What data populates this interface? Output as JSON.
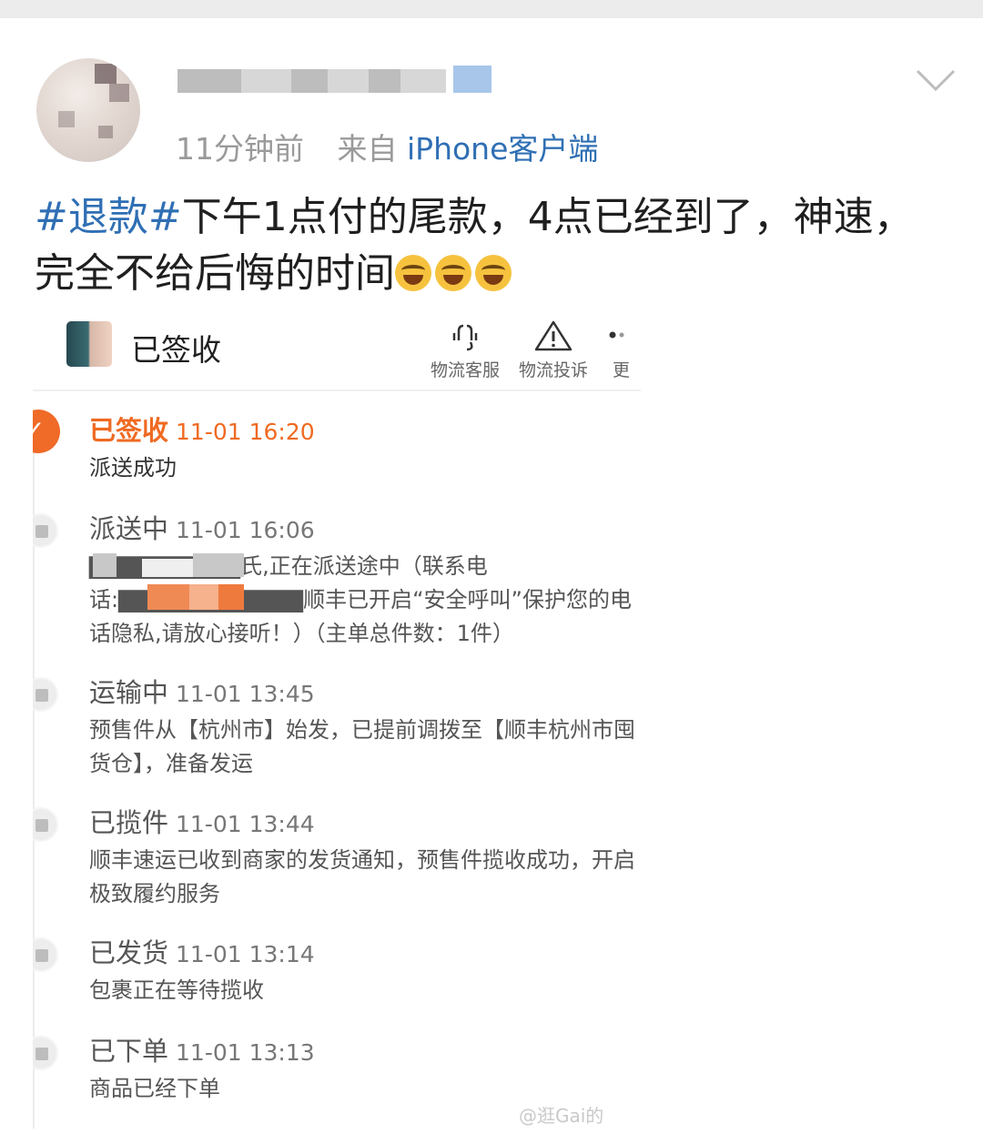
{
  "post": {
    "time": "11分钟前",
    "source_prefix": "来自",
    "source_link": "iPhone客户端",
    "hashtag": "#退款#",
    "body_line1": "下午1点付的尾款，4点已经到了，神速，",
    "body_line2": "完全不给后悔的时间"
  },
  "shipment": {
    "status_title": "已签收",
    "actions": [
      {
        "label": "物流客服",
        "icon": "headset-icon"
      },
      {
        "label": "物流投诉",
        "icon": "warning-icon"
      },
      {
        "label": "更",
        "icon": "more-icon"
      }
    ],
    "events": [
      {
        "status": "已签收",
        "time": "11-01 16:20",
        "desc": "派送成功"
      },
      {
        "status": "派送中",
        "time": "11-01 16:06",
        "desc": "▇▇▇▇▇▇▇▇▇氏,正在派送途中（联系电话:▇▇▇▇▇▇▇▇▇▇▇顺丰已开启“安全呼叫”保护您的电话隐私,请放心接听！）（主单总件数：1件）"
      },
      {
        "status": "运输中",
        "time": "11-01 13:45",
        "desc": "预售件从【杭州市】始发，已提前调拨至【顺丰杭州市囤货仓】，准备发运"
      },
      {
        "status": "已揽件",
        "time": "11-01 13:44",
        "desc": "顺丰速运已收到商家的发货通知，预售件揽收成功，开启极致履约服务"
      },
      {
        "status": "已发货",
        "time": "11-01 13:14",
        "desc": "包裹正在等待揽收"
      },
      {
        "status": "已下单",
        "time": "11-01 13:13",
        "desc": "商品已经下单"
      }
    ]
  },
  "watermark": "@逛Gai的"
}
